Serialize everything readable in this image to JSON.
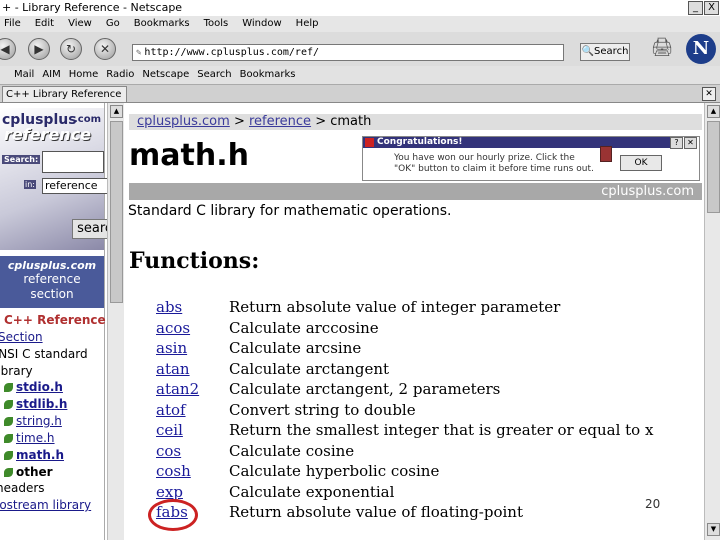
{
  "window": {
    "title": "+ - Library Reference - Netscape",
    "controls": [
      "_",
      "X"
    ]
  },
  "menu": [
    "File",
    "Edit",
    "View",
    "Go",
    "Bookmarks",
    "Tools",
    "Window",
    "Help"
  ],
  "nav": {
    "url": "http://www.cplusplus.com/ref/",
    "search_label": "Search"
  },
  "personal_toolbar": [
    "Mail",
    "AIM",
    "Home",
    "Radio",
    "Netscape",
    "Search",
    "Bookmarks"
  ],
  "tab": {
    "label": "C++ Library Reference"
  },
  "sidebar": {
    "logo_top": "cplusplus",
    "logo_com": ".com",
    "logo_ref": "reference",
    "search_label": "Search:",
    "in_label": "in:",
    "in_value": "reference",
    "search_button": "search",
    "section_title": "cplusplus.com",
    "section_sub1": "reference",
    "section_sub2": "section",
    "heading": "C++ Reference",
    "items": [
      "Section",
      "ANSI C standard",
      "library"
    ],
    "leaves": [
      "stdio.h",
      "stdlib.h",
      "string.h",
      "time.h",
      "math.h",
      "other"
    ],
    "items2": [
      "headers",
      "iostream library"
    ]
  },
  "main": {
    "breadcrumb": {
      "site": "cplusplus.com",
      "sep": ">",
      "section": "reference",
      "current": "cmath"
    },
    "title": "math.h",
    "ribbon": "cplusplus.com",
    "description": "Standard C library for mathematic operations.",
    "functions_heading": "Functions:",
    "functions": [
      {
        "name": "abs",
        "desc": "Return absolute value of integer parameter"
      },
      {
        "name": "acos",
        "desc": "Calculate arccosine"
      },
      {
        "name": "asin",
        "desc": "Calculate arcsine"
      },
      {
        "name": "atan",
        "desc": "Calculate arctangent"
      },
      {
        "name": "atan2",
        "desc": "Calculate arctangent, 2 parameters"
      },
      {
        "name": "atof",
        "desc": "Convert string to double"
      },
      {
        "name": "ceil",
        "desc": "Return the smallest integer that is greater or equal to x"
      },
      {
        "name": "cos",
        "desc": "Calculate cosine"
      },
      {
        "name": "cosh",
        "desc": "Calculate hyperbolic cosine"
      },
      {
        "name": "exp",
        "desc": "Calculate exponential"
      },
      {
        "name": "fabs",
        "desc": "Return absolute value of floating-point"
      }
    ],
    "page_number": "20"
  },
  "ad": {
    "header": "Congratulations!",
    "text": "You have won our hourly prize. Click the \"OK\" button to claim it before time runs out.",
    "ok": "OK"
  }
}
